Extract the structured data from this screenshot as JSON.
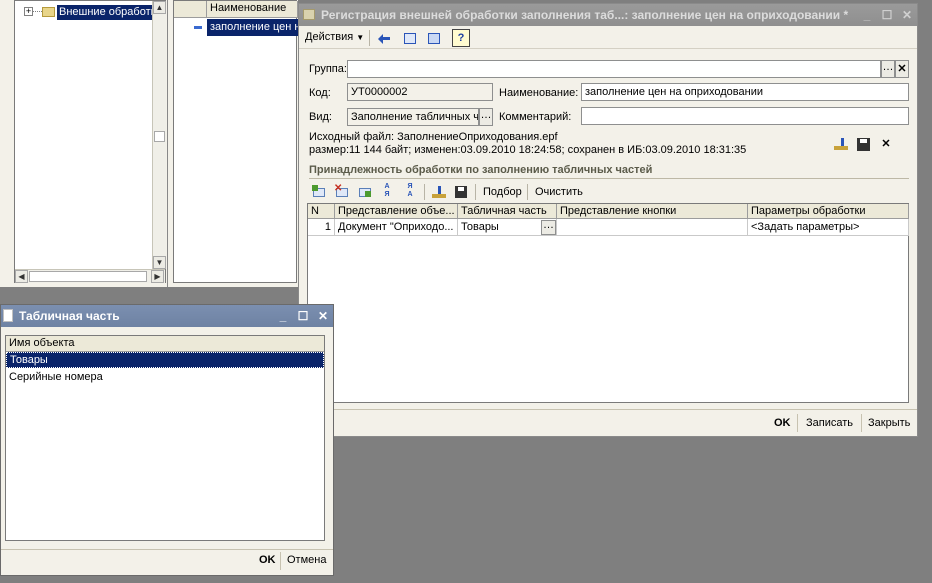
{
  "tree_panel": {
    "root_item": "Внешние обработки"
  },
  "list_panel": {
    "column_header": "Наименование",
    "row_value": "заполнение цен на оприходовании"
  },
  "main_window": {
    "title": "Регистрация внешней обработки заполнения таб...: заполнение цен на оприходовании *",
    "toolbar": {
      "actions_label": "Действия"
    },
    "group_label": "Группа:",
    "group_value": "",
    "code_label": "Код:",
    "code_value": "УТ0000002",
    "name_label": "Наименование:",
    "name_value": "заполнение цен на оприходовании",
    "kind_label": "Вид:",
    "kind_value": "Заполнение табличных ч",
    "comment_label": "Комментарий:",
    "comment_value": "",
    "source_file_line": "Исходный файл: ЗаполнениеОприходования.epf",
    "size_line": "размер:11 144 байт; изменен:03.09.2010 18:24:58; сохранен в ИБ:03.09.2010 18:31:35",
    "section_title": "Принадлежность обработки по заполнению табличных частей",
    "table_toolbar": {
      "pick_label": "Подбор",
      "clear_label": "Очистить"
    },
    "table": {
      "columns": [
        "N",
        "Представление объе...",
        "Табличная часть",
        "Представление кнопки",
        "Параметры обработки"
      ],
      "rows": [
        {
          "n": "1",
          "object": "Документ \"Оприходо...",
          "tab_part": "Товары",
          "button": "",
          "params": "<Задать параметры>"
        }
      ]
    },
    "footer": {
      "ok_label": "OK",
      "save_label": "Записать",
      "close_label": "Закрыть"
    }
  },
  "dialog": {
    "title": "Табличная часть",
    "column_header": "Имя объекта",
    "items": [
      "Товары",
      "Серийные номера"
    ],
    "ok_label": "OK",
    "cancel_label": "Отмена"
  },
  "colors": {
    "active_title": "#6e82a3",
    "selection": "#0a246a",
    "panel": "#f3f1e9"
  }
}
